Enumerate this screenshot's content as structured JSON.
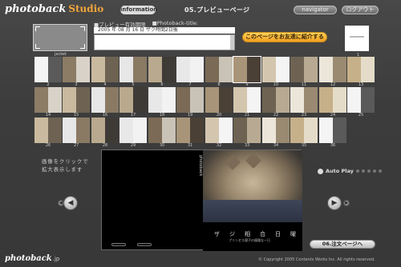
{
  "header": {
    "logo_main": "photoback",
    "logo_studio": "Studio",
    "info_button": "information",
    "step_title": "05.プレビューページ",
    "navigator_button": "navigator",
    "logout_button": "ログアウト"
  },
  "form": {
    "expiry_label": "■プレビュー有効期限",
    "title_label": "■Photoback-title:",
    "expiry_value": "2005 年 08 月 16 日 ザク時間2日後",
    "intro_button": "このページをお友達に紹介する",
    "cover_caption": "jacket",
    "first_page_number": "1"
  },
  "thumbnails": {
    "numbers": [
      "2",
      "3",
      "4",
      "5",
      "6",
      "7",
      "8",
      "9",
      "10",
      "11",
      "12",
      "13",
      "14",
      "15",
      "16",
      "17",
      "18",
      "19",
      "20",
      "21",
      "22",
      "23",
      "24",
      "25",
      "26",
      "27",
      "28",
      "29",
      "30",
      "31",
      "32",
      "33",
      "34",
      "35",
      "36"
    ]
  },
  "viewer": {
    "hint": "画像をクリックで 拡大表示します",
    "auto_play": "Auto Play",
    "vertical_text": "photoback",
    "caption_chars": [
      "ザ",
      "ジ",
      "相",
      "合",
      "日",
      "曜"
    ],
    "sub_caption": "プリンセス寝子の優雅な一日",
    "left_page_number": "",
    "next_button": "06.注文ページへ"
  },
  "footer": {
    "logo_main": "photoback",
    "logo_tld": ".jp",
    "copyright": "© Copyright 2005 Contents Works Inc.  All rights reserved."
  },
  "colors": {
    "accent_orange": "#f3a53a",
    "background": "#3a3a3a"
  }
}
